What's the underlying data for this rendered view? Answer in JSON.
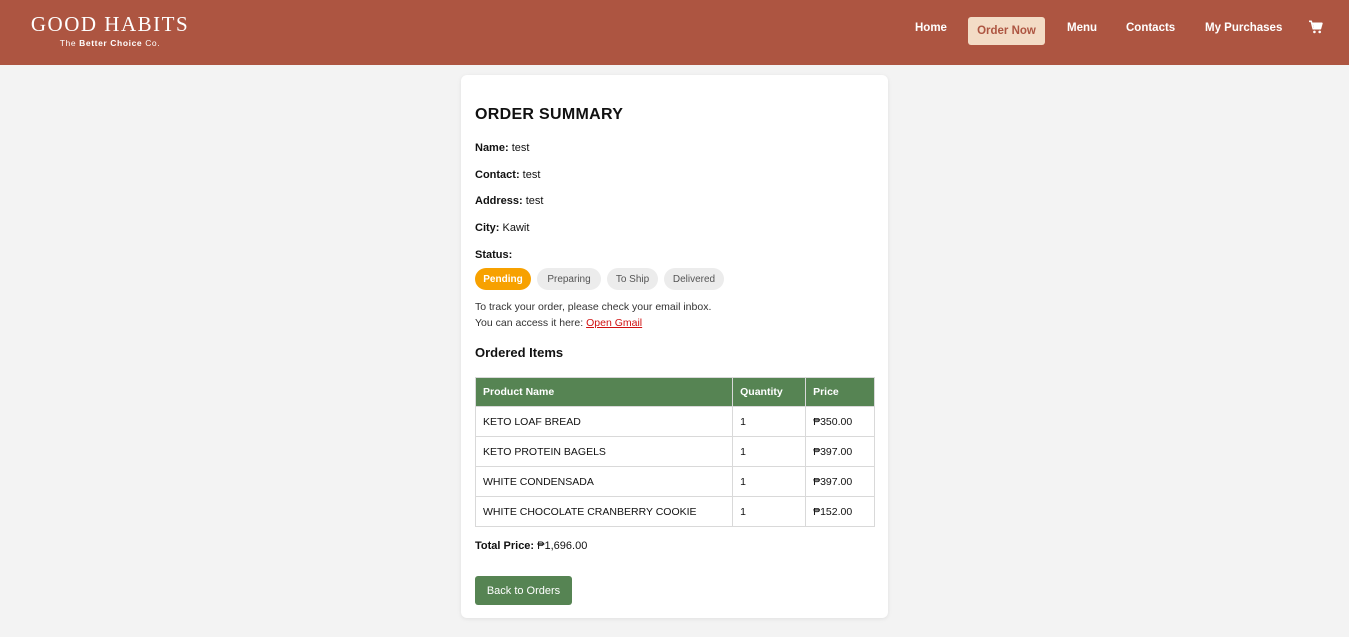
{
  "header": {
    "brand_name": "GOOD HABITS",
    "brand_tag_prefix": "The ",
    "brand_tag_bold": "Better Choice",
    "brand_tag_suffix": " Co.",
    "nav": [
      {
        "label": "Home"
      },
      {
        "label": "Order Now",
        "active": true
      },
      {
        "label": "Menu"
      },
      {
        "label": "Contacts"
      },
      {
        "label": "My Purchases"
      }
    ],
    "cart_icon": "cart-icon",
    "colors": {
      "bar": "#ad5541",
      "active_bg": "#f3dcc6"
    }
  },
  "summary": {
    "title": "ORDER SUMMARY",
    "name_label": "Name:",
    "name_value": "test",
    "contact_label": "Contact:",
    "contact_value": "test",
    "address_label": "Address:",
    "address_value": "test",
    "city_label": "City:",
    "city_value": "Kawit",
    "status_label": "Status:",
    "statuses": [
      {
        "label": "Pending",
        "active": true
      },
      {
        "label": "Preparing"
      },
      {
        "label": "To Ship"
      },
      {
        "label": "Delivered"
      }
    ],
    "track_line1": "To track your order, please check your email inbox.",
    "track_line2": "You can access it here: ",
    "track_link": "Open Gmail",
    "items_title": "Ordered Items",
    "table_headers": [
      "Product Name",
      "Quantity",
      "Price"
    ],
    "items": [
      {
        "name": "KETO LOAF BREAD",
        "qty": "1",
        "price": "₱350.00"
      },
      {
        "name": "KETO PROTEIN BAGELS",
        "qty": "1",
        "price": "₱397.00"
      },
      {
        "name": "WHITE CONDENSADA",
        "qty": "1",
        "price": "₱397.00"
      },
      {
        "name": "WHITE CHOCOLATE CRANBERRY COOKIE",
        "qty": "1",
        "price": "₱152.00"
      }
    ],
    "total_label": "Total Price:",
    "total_value": "₱1,696.00",
    "back_button": "Back to Orders",
    "colors": {
      "accent_green": "#568453",
      "pending": "#f7a100",
      "link": "#d01010"
    }
  }
}
